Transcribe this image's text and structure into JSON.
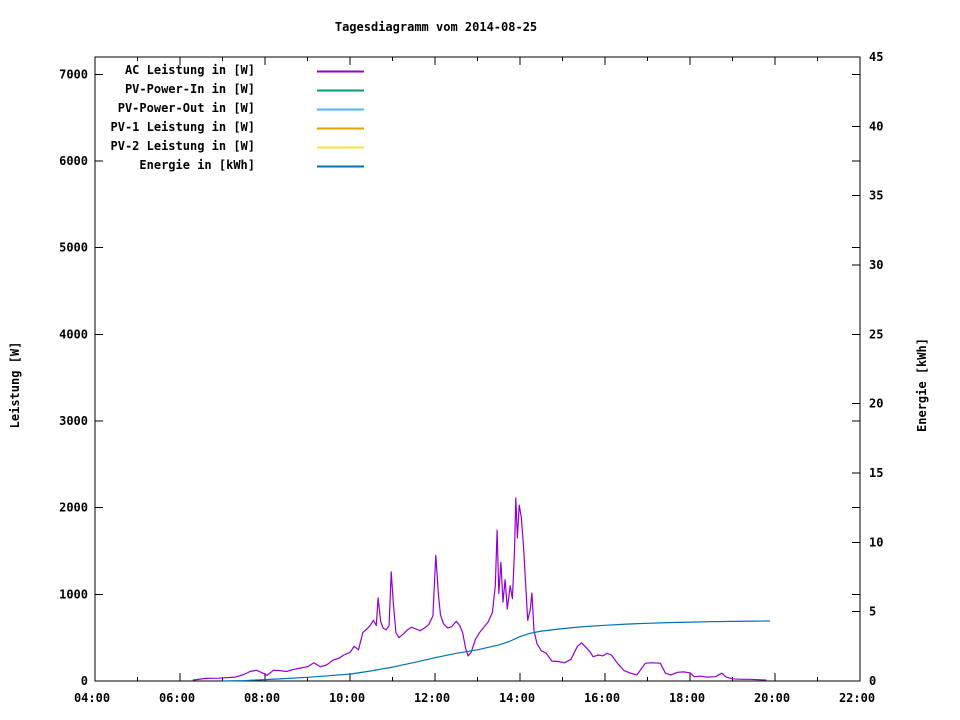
{
  "chart_data": {
    "type": "line",
    "title": "Tagesdiagramm vom 2014-08-25",
    "grid": false,
    "legend_position": "top-left-inside",
    "x_axis": {
      "kind": "time",
      "range": [
        4,
        22
      ],
      "major_ticks": [
        {
          "h": 4,
          "label": "04:00"
        },
        {
          "h": 6,
          "label": "06:00"
        },
        {
          "h": 8,
          "label": "08:00"
        },
        {
          "h": 10,
          "label": "10:00"
        },
        {
          "h": 12,
          "label": "12:00"
        },
        {
          "h": 14,
          "label": "14:00"
        },
        {
          "h": 16,
          "label": "16:00"
        },
        {
          "h": 18,
          "label": "18:00"
        },
        {
          "h": 20,
          "label": "20:00"
        },
        {
          "h": 22,
          "label": "22:00"
        }
      ],
      "minor_ticks": [
        5,
        7,
        9,
        11,
        13,
        15,
        17,
        19,
        21
      ]
    },
    "y_axis": {
      "label": "Leistung [W]",
      "range": [
        0,
        7200
      ],
      "ticks": [
        {
          "v": 0,
          "label": "0"
        },
        {
          "v": 1000,
          "label": "1000"
        },
        {
          "v": 2000,
          "label": "2000"
        },
        {
          "v": 3000,
          "label": "3000"
        },
        {
          "v": 4000,
          "label": "4000"
        },
        {
          "v": 5000,
          "label": "5000"
        },
        {
          "v": 6000,
          "label": "6000"
        },
        {
          "v": 7000,
          "label": "7000"
        }
      ]
    },
    "y2_axis": {
      "label": "Energie [kWh]",
      "range": [
        0,
        45
      ],
      "ticks": [
        {
          "v": 0,
          "label": "0"
        },
        {
          "v": 5,
          "label": "5"
        },
        {
          "v": 10,
          "label": "10"
        },
        {
          "v": 15,
          "label": "15"
        },
        {
          "v": 20,
          "label": "20"
        },
        {
          "v": 25,
          "label": "25"
        },
        {
          "v": 30,
          "label": "30"
        },
        {
          "v": 35,
          "label": "35"
        },
        {
          "v": 40,
          "label": "40"
        },
        {
          "v": 45,
          "label": "45"
        }
      ]
    },
    "series": [
      {
        "name": "AC Leistung in [W]",
        "color": "#9400d3",
        "axis": "y",
        "points": [
          [
            6.3,
            10
          ],
          [
            6.6,
            30
          ],
          [
            6.9,
            32
          ],
          [
            7.1,
            38
          ],
          [
            7.3,
            45
          ],
          [
            7.5,
            75
          ],
          [
            7.65,
            110
          ],
          [
            7.8,
            125
          ],
          [
            7.95,
            90
          ],
          [
            8.05,
            65
          ],
          [
            8.2,
            125
          ],
          [
            8.35,
            120
          ],
          [
            8.5,
            110
          ],
          [
            8.65,
            130
          ],
          [
            8.8,
            145
          ],
          [
            9.0,
            165
          ],
          [
            9.15,
            210
          ],
          [
            9.3,
            165
          ],
          [
            9.45,
            185
          ],
          [
            9.6,
            240
          ],
          [
            9.75,
            265
          ],
          [
            9.85,
            300
          ],
          [
            10.0,
            330
          ],
          [
            10.1,
            400
          ],
          [
            10.2,
            360
          ],
          [
            10.3,
            560
          ],
          [
            10.4,
            600
          ],
          [
            10.48,
            645
          ],
          [
            10.55,
            700
          ],
          [
            10.62,
            640
          ],
          [
            10.66,
            960
          ],
          [
            10.72,
            690
          ],
          [
            10.78,
            610
          ],
          [
            10.85,
            590
          ],
          [
            10.92,
            640
          ],
          [
            10.97,
            1260
          ],
          [
            11.02,
            900
          ],
          [
            11.08,
            560
          ],
          [
            11.15,
            500
          ],
          [
            11.25,
            540
          ],
          [
            11.35,
            590
          ],
          [
            11.45,
            620
          ],
          [
            11.55,
            600
          ],
          [
            11.65,
            580
          ],
          [
            11.75,
            610
          ],
          [
            11.85,
            650
          ],
          [
            11.95,
            750
          ],
          [
            12.02,
            1450
          ],
          [
            12.08,
            1000
          ],
          [
            12.13,
            760
          ],
          [
            12.2,
            660
          ],
          [
            12.3,
            610
          ],
          [
            12.4,
            630
          ],
          [
            12.5,
            690
          ],
          [
            12.58,
            640
          ],
          [
            12.65,
            560
          ],
          [
            12.72,
            380
          ],
          [
            12.78,
            290
          ],
          [
            12.85,
            330
          ],
          [
            12.95,
            480
          ],
          [
            13.05,
            560
          ],
          [
            13.15,
            620
          ],
          [
            13.25,
            680
          ],
          [
            13.35,
            790
          ],
          [
            13.42,
            1100
          ],
          [
            13.46,
            1740
          ],
          [
            13.5,
            1010
          ],
          [
            13.55,
            1370
          ],
          [
            13.6,
            910
          ],
          [
            13.65,
            1170
          ],
          [
            13.7,
            830
          ],
          [
            13.77,
            1100
          ],
          [
            13.82,
            950
          ],
          [
            13.87,
            1500
          ],
          [
            13.9,
            2110
          ],
          [
            13.94,
            1650
          ],
          [
            13.98,
            2030
          ],
          [
            14.03,
            1890
          ],
          [
            14.08,
            1570
          ],
          [
            14.12,
            1230
          ],
          [
            14.18,
            700
          ],
          [
            14.24,
            820
          ],
          [
            14.28,
            1015
          ],
          [
            14.33,
            580
          ],
          [
            14.4,
            430
          ],
          [
            14.5,
            350
          ],
          [
            14.62,
            320
          ],
          [
            14.75,
            230
          ],
          [
            14.9,
            225
          ],
          [
            15.05,
            210
          ],
          [
            15.2,
            250
          ],
          [
            15.35,
            400
          ],
          [
            15.45,
            440
          ],
          [
            15.55,
            390
          ],
          [
            15.65,
            335
          ],
          [
            15.72,
            280
          ],
          [
            15.85,
            300
          ],
          [
            15.95,
            290
          ],
          [
            16.05,
            320
          ],
          [
            16.15,
            300
          ],
          [
            16.3,
            200
          ],
          [
            16.45,
            120
          ],
          [
            16.6,
            90
          ],
          [
            16.75,
            70
          ],
          [
            16.95,
            205
          ],
          [
            17.1,
            210
          ],
          [
            17.3,
            205
          ],
          [
            17.42,
            90
          ],
          [
            17.55,
            70
          ],
          [
            17.7,
            100
          ],
          [
            17.85,
            105
          ],
          [
            18.0,
            95
          ],
          [
            18.1,
            50
          ],
          [
            18.25,
            55
          ],
          [
            18.4,
            45
          ],
          [
            18.6,
            50
          ],
          [
            18.75,
            90
          ],
          [
            18.85,
            45
          ],
          [
            19.0,
            25
          ],
          [
            19.2,
            20
          ],
          [
            19.4,
            20
          ],
          [
            19.6,
            15
          ],
          [
            19.8,
            10
          ]
        ]
      },
      {
        "name": "PV-Power-In in [W]",
        "color": "#009e73",
        "axis": "y",
        "points": []
      },
      {
        "name": "PV-Power-Out in [W]",
        "color": "#56b4e9",
        "axis": "y",
        "points": []
      },
      {
        "name": "PV-1 Leistung in [W]",
        "color": "#e69f00",
        "axis": "y",
        "points": []
      },
      {
        "name": "PV-2 Leistung in [W]",
        "color": "#f0e442",
        "axis": "y",
        "points": []
      },
      {
        "name": "Energie in [kWh]",
        "color": "#0072b2",
        "axis": "y2",
        "points": [
          [
            7.0,
            0.0
          ],
          [
            7.5,
            0.03
          ],
          [
            8.0,
            0.1
          ],
          [
            8.5,
            0.18
          ],
          [
            9.0,
            0.27
          ],
          [
            9.5,
            0.38
          ],
          [
            10.0,
            0.5
          ],
          [
            10.5,
            0.73
          ],
          [
            11.0,
            1.0
          ],
          [
            11.5,
            1.33
          ],
          [
            12.0,
            1.68
          ],
          [
            12.5,
            2.0
          ],
          [
            13.0,
            2.25
          ],
          [
            13.5,
            2.6
          ],
          [
            13.75,
            2.85
          ],
          [
            14.0,
            3.2
          ],
          [
            14.25,
            3.45
          ],
          [
            14.5,
            3.6
          ],
          [
            15.0,
            3.78
          ],
          [
            15.5,
            3.92
          ],
          [
            16.0,
            4.02
          ],
          [
            16.5,
            4.1
          ],
          [
            17.0,
            4.16
          ],
          [
            17.5,
            4.21
          ],
          [
            18.0,
            4.25
          ],
          [
            18.5,
            4.28
          ],
          [
            19.0,
            4.3
          ],
          [
            19.5,
            4.32
          ],
          [
            19.88,
            4.33
          ]
        ]
      }
    ]
  }
}
